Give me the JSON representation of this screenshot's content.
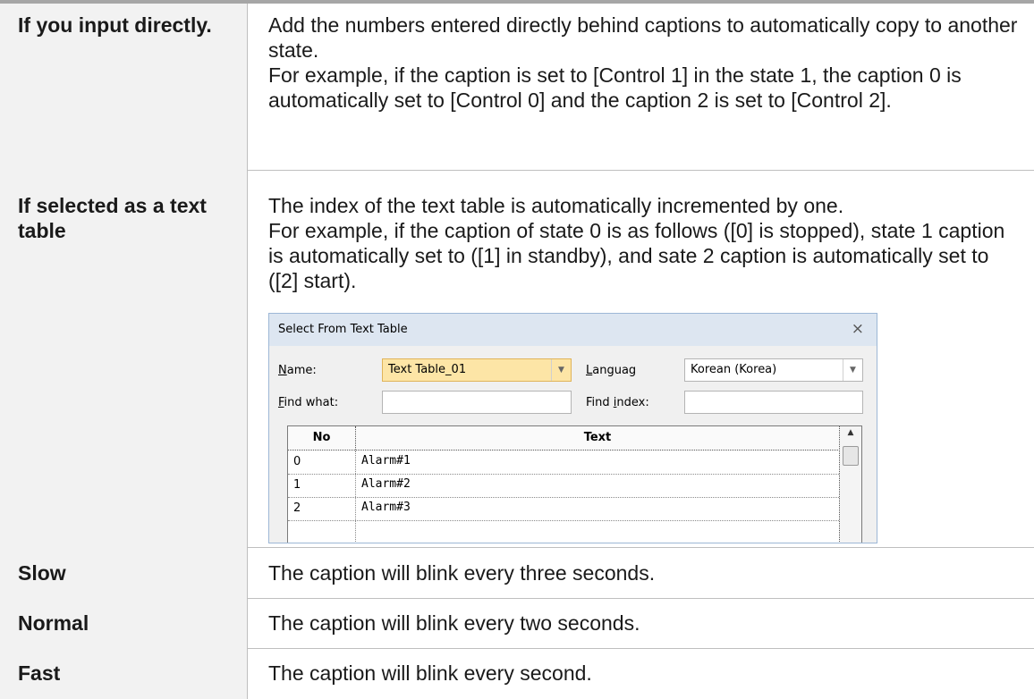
{
  "rows": [
    {
      "key": "If you input directly.",
      "paragraphs": [
        "Add the numbers entered directly behind captions to automatically copy to another state.",
        "For example, if the caption is set to [Control 1] in the state 1, the caption 0 is automatically set to [Control 0] and the caption 2 is set to [Control 2]."
      ]
    },
    {
      "key": "If selected as a text table",
      "paragraphs": [
        "The index of the text table is automatically incremented by one.",
        "For example, if the caption of state 0 is as follows ([0] is stopped), state 1 caption is automatically set to ([1] in standby), and sate 2 caption is automatically set to ([2] start)."
      ]
    },
    {
      "key": "Slow",
      "paragraphs": [
        "The caption will blink every three seconds."
      ]
    },
    {
      "key": "Normal",
      "paragraphs": [
        "The caption will blink every two seconds."
      ]
    },
    {
      "key": "Fast",
      "paragraphs": [
        "The caption will blink every second."
      ]
    }
  ],
  "dialog": {
    "title": "Select From Text Table",
    "close_glyph": "×",
    "name_label_u": "N",
    "name_label_rest": "ame:",
    "name_value": "Text Table_01",
    "language_label_u": "L",
    "language_label_rest": "anguag",
    "language_value": "Korean (Korea)",
    "find_what_label_u": "F",
    "find_what_label_rest": "ind what:",
    "find_what_value": "",
    "find_index_label_pre": "Find ",
    "find_index_label_u": "i",
    "find_index_label_rest": "ndex:",
    "find_index_value": "",
    "columns": [
      "No",
      "Text"
    ],
    "rows": [
      {
        "no": "0",
        "text": "Alarm#1"
      },
      {
        "no": "1",
        "text": "Alarm#2"
      },
      {
        "no": "2",
        "text": "Alarm#3"
      },
      {
        "no": "",
        "text": ""
      }
    ]
  }
}
